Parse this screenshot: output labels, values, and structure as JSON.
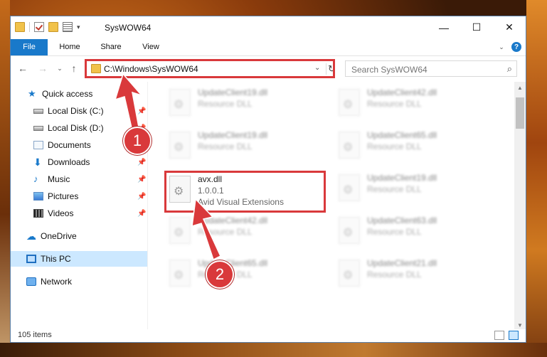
{
  "window": {
    "title": "SysWOW64",
    "buttons": {
      "minimize": "—",
      "maximize": "☐",
      "close": "✕"
    }
  },
  "ribbon": {
    "tabs": [
      "File",
      "Home",
      "Share",
      "View"
    ],
    "help": "?"
  },
  "address": {
    "path": "C:\\Windows\\SysWOW64",
    "search_placeholder": "Search SysWOW64"
  },
  "sidebar": {
    "items": [
      {
        "label": "Quick access",
        "icon": "star-icon"
      },
      {
        "label": "Local Disk (C:)",
        "icon": "disk-icon",
        "pinned": true
      },
      {
        "label": "Local Disk (D:)",
        "icon": "disk-icon",
        "pinned": true
      },
      {
        "label": "Documents",
        "icon": "documents-icon",
        "pinned": true
      },
      {
        "label": "Downloads",
        "icon": "downloads-icon",
        "pinned": true
      },
      {
        "label": "Music",
        "icon": "music-icon",
        "pinned": true
      },
      {
        "label": "Pictures",
        "icon": "pictures-icon",
        "pinned": true
      },
      {
        "label": "Videos",
        "icon": "videos-icon",
        "pinned": true
      },
      {
        "label": "OneDrive",
        "icon": "onedrive-icon"
      },
      {
        "label": "This PC",
        "icon": "pc-icon",
        "selected": true
      },
      {
        "label": "Network",
        "icon": "network-icon"
      }
    ]
  },
  "files": [
    {
      "name": "UpdateClient19.dll",
      "type": "Resource DLL"
    },
    {
      "name": "UpdateClient42.dll",
      "type": "Resource DLL"
    },
    {
      "name": "UpdateClient19.dll",
      "type": "Resource DLL"
    },
    {
      "name": "UpdateClient65.dll",
      "type": "Resource DLL"
    },
    {
      "name": "avx.dll",
      "version": "1.0.0.1",
      "description": "Avid Visual Extensions"
    },
    {
      "name": "UpdateClient19.dll",
      "type": "Resource DLL"
    },
    {
      "name": "UpdateClient42.dll",
      "type": "Resource DLL"
    },
    {
      "name": "UpdateClient63.dll",
      "type": "Resource DLL"
    },
    {
      "name": "UpdateClient65.dll",
      "type": "Resource DLL"
    },
    {
      "name": "UpdateClient21.dll",
      "type": "Resource DLL"
    }
  ],
  "status": {
    "item_count": "105 items"
  },
  "callouts": [
    "1",
    "2"
  ],
  "colors": {
    "accent": "#1979ca",
    "highlight": "#d9393b",
    "selected": "#cce8ff"
  }
}
